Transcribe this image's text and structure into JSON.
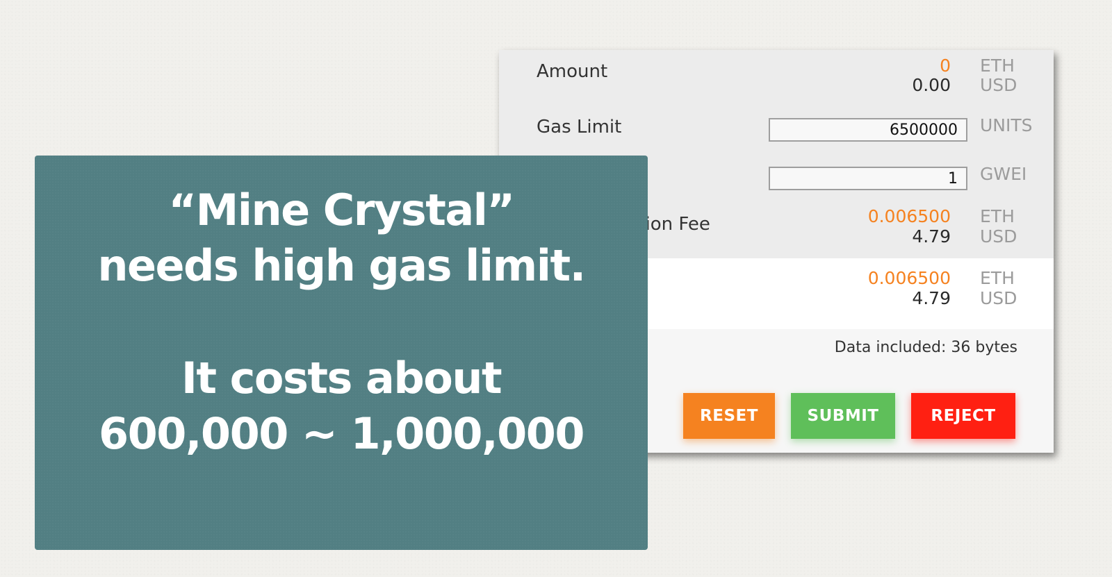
{
  "dialog": {
    "amount": {
      "label": "Amount",
      "eth_value": "0",
      "eth_unit": "ETH",
      "usd_value": "0.00",
      "usd_unit": "USD"
    },
    "gas_limit": {
      "label": "Gas Limit",
      "value": "6500000",
      "unit": "UNITS"
    },
    "gas_price": {
      "value": "1",
      "unit": "GWEI"
    },
    "transaction_fee": {
      "label_visible": "ction Fee",
      "eth_value": "0.006500",
      "eth_unit": "ETH",
      "usd_value": "4.79",
      "usd_unit": "USD"
    },
    "total": {
      "eth_value": "0.006500",
      "eth_unit": "ETH",
      "usd_value": "4.79",
      "usd_unit": "USD"
    },
    "data_included": "Data included: 36 bytes",
    "buttons": {
      "reset": "RESET",
      "submit": "SUBMIT",
      "reject": "REJECT"
    }
  },
  "caption": {
    "line1": "“Mine Crystal”",
    "line2": "needs high gas limit.",
    "line3": "It costs about",
    "line4": "600,000 ~ 1,000,000"
  },
  "colors": {
    "page_background": "#f1f0ec",
    "card_background": "#527f83",
    "accent_orange": "#f58220",
    "submit_green": "#5fbf5a",
    "reject_red": "#ff2012"
  }
}
